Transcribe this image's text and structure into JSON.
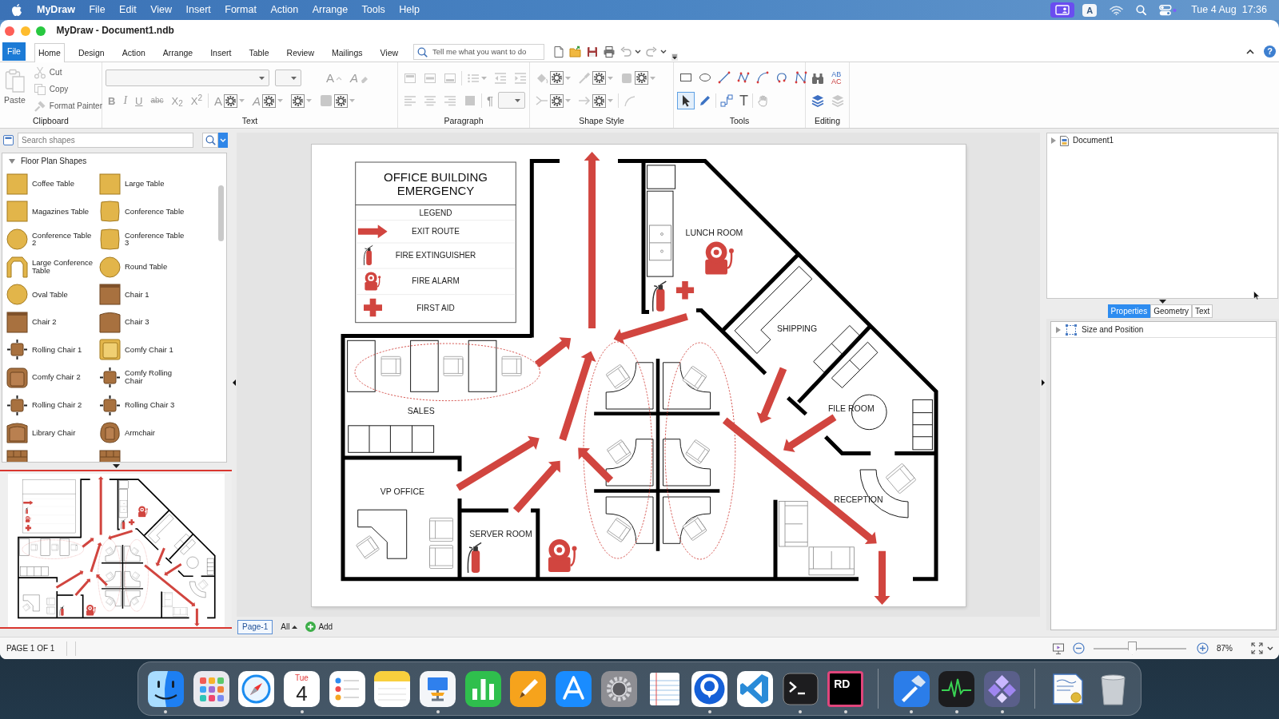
{
  "menu_bar": {
    "app_name": "MyDraw",
    "menus": [
      "File",
      "Edit",
      "View",
      "Insert",
      "Format",
      "Action",
      "Arrange",
      "Tools",
      "Help"
    ],
    "input_source": "A",
    "date": "Tue 4 Aug",
    "time": "17:36"
  },
  "window": {
    "title": "MyDraw - Document1.ndb"
  },
  "ribbon": {
    "file_tab": "File",
    "tabs": [
      {
        "label": "Home",
        "selected": true
      },
      {
        "label": "Design",
        "selected": false
      },
      {
        "label": "Action",
        "selected": false
      },
      {
        "label": "Arrange",
        "selected": false
      },
      {
        "label": "Insert",
        "selected": false
      },
      {
        "label": "Table",
        "selected": false
      },
      {
        "label": "Review",
        "selected": false
      },
      {
        "label": "Mailings",
        "selected": false
      },
      {
        "label": "View",
        "selected": false
      }
    ],
    "search": {
      "placeholder": "Tell me what you want to do"
    },
    "quick_access": [
      {
        "kind": "new",
        "disabled": false
      },
      {
        "kind": "open",
        "disabled": false
      },
      {
        "kind": "save",
        "disabled": false
      },
      {
        "kind": "print",
        "disabled": false
      },
      {
        "kind": "undo",
        "disabled": true,
        "menu": true
      },
      {
        "kind": "redo",
        "disabled": true,
        "menu": true
      }
    ],
    "help": "?",
    "groups": [
      {
        "label": "Clipboard",
        "large": {
          "kind": "paste",
          "label": "Paste",
          "disabled": true
        },
        "rows": [
          [
            {
              "kind": "cut",
              "label": "Cut",
              "disabled": true
            }
          ],
          [
            {
              "kind": "copy",
              "label": "Copy",
              "disabled": true
            }
          ],
          [
            {
              "kind": "painter",
              "label": "Format Painter",
              "disabled": true
            }
          ]
        ]
      },
      {
        "label": "Text",
        "rows": [
          [
            {
              "kind": "font-select",
              "disabled": true
            },
            {
              "kind": "size-select",
              "disabled": true
            },
            {
              "kind": "grow-font",
              "label": "A",
              "disabled": true
            },
            {
              "kind": "clear-format",
              "label": "A",
              "disabled": true
            }
          ],
          [
            {
              "kind": "bold",
              "label": "B",
              "disabled": true
            },
            {
              "kind": "italic",
              "label": "I",
              "disabled": true
            },
            {
              "kind": "underline",
              "label": "U",
              "disabled": true
            },
            {
              "kind": "strike",
              "label": "abc",
              "disabled": true
            },
            {
              "kind": "subscript",
              "label": "X$_{2}$",
              "disabled": true
            },
            {
              "kind": "superscript",
              "label": "X$^{2}$",
              "disabled": true
            },
            {
              "kind": "sep"
            },
            {
              "kind": "font-color",
              "label": "A",
              "disabled": true,
              "menu": true
            },
            {
              "kind": "highlight",
              "label": "A",
              "disabled": true,
              "menu": true
            },
            {
              "kind": "gear",
              "disabled": true,
              "menu": true
            },
            {
              "kind": "box-gear",
              "disabled": true,
              "menu": true
            }
          ]
        ]
      },
      {
        "label": "Paragraph",
        "rows": [
          [
            {
              "kind": "valign-top",
              "disabled": true
            },
            {
              "kind": "valign-middle",
              "disabled": true
            },
            {
              "kind": "valign-bottom",
              "disabled": true
            },
            {
              "kind": "sep"
            },
            {
              "kind": "bullets",
              "disabled": true,
              "menu": true
            },
            {
              "kind": "outdent",
              "disabled": true
            },
            {
              "kind": "indent",
              "disabled": true
            }
          ],
          [
            {
              "kind": "align-left",
              "disabled": true
            },
            {
              "kind": "align-center",
              "disabled": true
            },
            {
              "kind": "align-right",
              "disabled": true
            },
            {
              "kind": "justify",
              "disabled": true
            },
            {
              "kind": "sep"
            },
            {
              "kind": "pilcrow",
              "label": "¶",
              "disabled": true
            },
            {
              "kind": "para-select",
              "disabled": true
            }
          ]
        ]
      },
      {
        "label": "Shape Style",
        "rows": [
          [
            {
              "kind": "fill",
              "disabled": true,
              "menu": true
            },
            {
              "kind": "line",
              "disabled": true,
              "menu": true
            },
            {
              "kind": "shadow",
              "disabled": true,
              "menu": true
            }
          ],
          [
            {
              "kind": "begin",
              "disabled": true,
              "menu": true
            },
            {
              "kind": "end",
              "disabled": true,
              "menu": true
            },
            {
              "kind": "sep"
            },
            {
              "kind": "curve",
              "disabled": true
            }
          ]
        ]
      },
      {
        "label": "Tools",
        "rows": [
          [
            {
              "kind": "rect",
              "selected": false,
              "disabled": false
            },
            {
              "kind": "ellipse",
              "selected": false,
              "disabled": false
            },
            {
              "kind": "line-tool",
              "selected": false,
              "disabled": false
            },
            {
              "kind": "polyline",
              "selected": false,
              "disabled": false
            },
            {
              "kind": "arc",
              "selected": false,
              "disabled": false
            },
            {
              "kind": "closed-curve",
              "selected": false,
              "disabled": false
            },
            {
              "kind": "curve-tool",
              "selected": false,
              "disabled": false
            }
          ],
          [
            {
              "kind": "pointer",
              "selected": true,
              "disabled": false
            },
            {
              "kind": "pencil",
              "selected": false,
              "disabled": false
            },
            {
              "kind": "sep"
            },
            {
              "kind": "connector",
              "selected": false,
              "disabled": false
            },
            {
              "kind": "text-tool",
              "label": "T",
              "selected": false,
              "disabled": false
            },
            {
              "kind": "sep"
            },
            {
              "kind": "hand",
              "selected": false,
              "disabled": true
            }
          ]
        ]
      },
      {
        "label": "Editing",
        "rows": [
          [
            {
              "kind": "find",
              "disabled": false
            },
            {
              "kind": "replace",
              "lines": [
                "AB",
                "AC"
              ],
              "disabled": false
            }
          ],
          [
            {
              "kind": "layers",
              "disabled": false
            },
            {
              "kind": "layers",
              "disabled": true
            }
          ]
        ]
      }
    ]
  },
  "left_panel": {
    "search": {
      "placeholder": "Search shapes"
    },
    "category": {
      "label": "Floor Plan Shapes",
      "expanded": true
    },
    "shapes": [
      {
        "kind": "square-table",
        "label": "Coffee Table"
      },
      {
        "kind": "square-table",
        "label": "Large Table"
      },
      {
        "kind": "square-table",
        "label": "Magazines Table"
      },
      {
        "kind": "barrel-table",
        "label": "Conference Table"
      },
      {
        "kind": "round-table",
        "label": "Conference Table 2"
      },
      {
        "kind": "barrel-table",
        "label": "Conference Table 3"
      },
      {
        "kind": "arch-table",
        "label": "Large Conference Table"
      },
      {
        "kind": "round-table",
        "label": "Round Table"
      },
      {
        "kind": "round-table",
        "label": "Oval Table"
      },
      {
        "kind": "chair",
        "label": "Chair 1"
      },
      {
        "kind": "chair",
        "label": "Chair 2"
      },
      {
        "kind": "chair-round",
        "label": "Chair 3"
      },
      {
        "kind": "rolling",
        "label": "Rolling Chair 1"
      },
      {
        "kind": "comfy-gold",
        "label": "Comfy Chair 1"
      },
      {
        "kind": "comfy",
        "label": "Comfy Chair 2"
      },
      {
        "kind": "rolling",
        "label": "Comfy Rolling Chair"
      },
      {
        "kind": "rolling",
        "label": "Rolling Chair 2"
      },
      {
        "kind": "rolling",
        "label": "Rolling Chair 3"
      },
      {
        "kind": "library",
        "label": "Library Chair"
      },
      {
        "kind": "armchair",
        "label": "Armchair"
      },
      {
        "kind": "sofa"
      },
      {
        "kind": "sofa"
      }
    ]
  },
  "canvas": {
    "floor_plan": {
      "legend": {
        "title": "OFFICE BUILDING EMERGENCY",
        "heading": "LEGEND",
        "items": [
          {
            "kind": "exit",
            "label": "EXIT ROUTE"
          },
          {
            "kind": "extinguisher",
            "label": "FIRE EXTINGUISHER"
          },
          {
            "kind": "alarm",
            "label": "FIRE ALARM"
          },
          {
            "kind": "aid",
            "label": "FIRST AID"
          }
        ]
      },
      "rooms": [
        {
          "label": "LUNCH ROOM"
        },
        {
          "label": "SHIPPING"
        },
        {
          "label": "SALES"
        },
        {
          "label": "FILE ROOM"
        },
        {
          "label": "VP OFFICE"
        },
        {
          "label": "RECEPTION"
        },
        {
          "label": "SERVER ROOM"
        }
      ]
    }
  },
  "page_tabs": {
    "pages": [
      {
        "label": "Page-1",
        "selected": true
      }
    ],
    "filter": "All",
    "add": "Add"
  },
  "right_panel": {
    "tree": [
      {
        "label": "Document1",
        "expanded": false
      }
    ],
    "tabs": [
      {
        "label": "Properties",
        "selected": true
      },
      {
        "label": "Geometry",
        "selected": false
      },
      {
        "label": "Text",
        "selected": false
      }
    ],
    "sections": [
      {
        "label": "Size and Position",
        "expanded": false
      }
    ]
  },
  "status_bar": {
    "page": "PAGE 1 OF 1",
    "zoom": {
      "level": 0.42,
      "reading": "87%"
    }
  },
  "dock": {
    "items": [
      {
        "kind": "face",
        "running": true
      },
      {
        "kind": "grid",
        "running": false
      },
      {
        "kind": "compass",
        "running": false
      },
      {
        "kind": "calendar",
        "weekday": "Tue",
        "day": "4",
        "running": true
      },
      {
        "kind": "checklist",
        "running": false
      },
      {
        "kind": "notepad",
        "running": false
      },
      {
        "kind": "podium",
        "running": true
      },
      {
        "kind": "bars",
        "running": false
      },
      {
        "kind": "pen",
        "running": false
      },
      {
        "kind": "letter",
        "running": false
      },
      {
        "kind": "gear",
        "running": false
      },
      {
        "kind": "sheet",
        "running": false
      },
      {
        "kind": "ring",
        "running": true
      },
      {
        "kind": "ribbon",
        "running": false
      },
      {
        "kind": "terminal",
        "running": true
      },
      {
        "kind": "letters",
        "label": "RD",
        "running": true
      },
      {
        "kind": "separator"
      },
      {
        "kind": "hammer",
        "running": true
      },
      {
        "kind": "pulse",
        "running": true
      },
      {
        "kind": "diamonds",
        "running": true
      },
      {
        "kind": "separator"
      },
      {
        "kind": "certificate"
      },
      {
        "kind": "trash"
      }
    ]
  }
}
